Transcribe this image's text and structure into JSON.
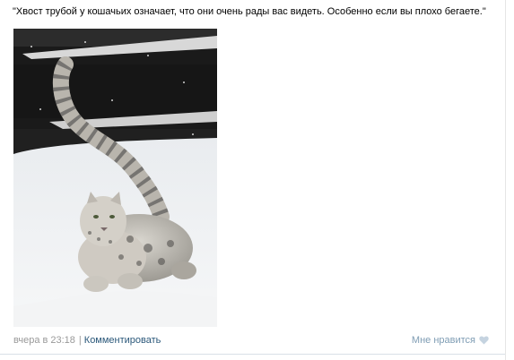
{
  "post": {
    "text": "\"Хвост трубой у кошачьих означает, что они очень рады вас видеть. Особенно если вы плохо бегаете.\""
  },
  "footer": {
    "timestamp": "вчера в 23:18",
    "separator": "|",
    "comment_label": "Комментировать",
    "like_label": "Мне нравится",
    "like_icon": "heart-icon"
  },
  "colors": {
    "link": "#2b587a",
    "meta": "#999999",
    "like": "#7f9db4"
  }
}
